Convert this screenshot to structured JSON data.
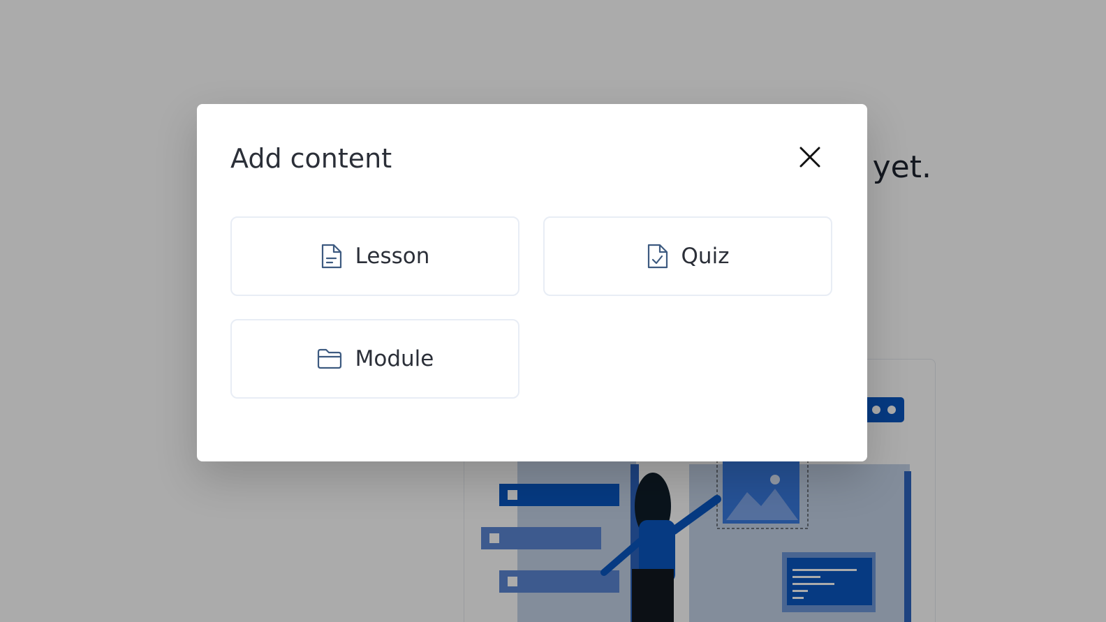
{
  "background": {
    "empty_text": "yet."
  },
  "modal": {
    "title": "Add content",
    "close_icon": "close-icon",
    "options": [
      {
        "label": "Lesson",
        "icon": "document-icon"
      },
      {
        "label": "Quiz",
        "icon": "document-check-icon"
      },
      {
        "label": "Module",
        "icon": "folder-icon"
      }
    ]
  },
  "colors": {
    "overlay": "#000000",
    "accent_blue": "#0a57c2",
    "card_border": "#e8edf5",
    "icon_stroke": "#3d5a80",
    "text": "#2b2f38"
  }
}
